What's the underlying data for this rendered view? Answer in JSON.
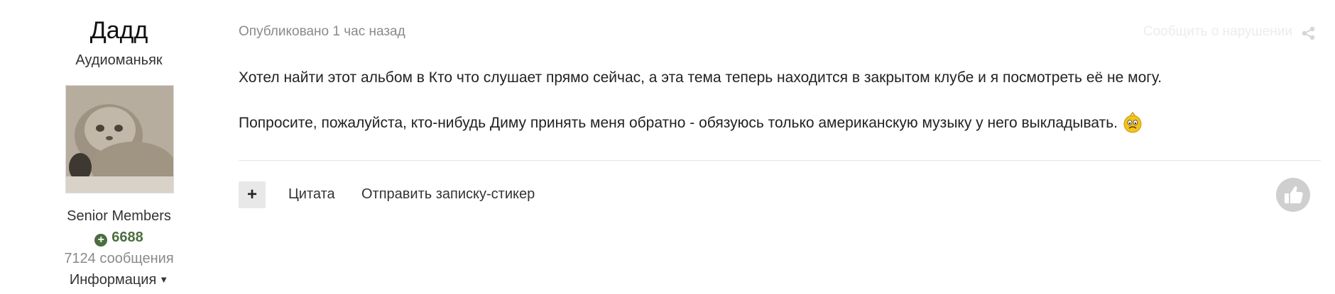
{
  "author": {
    "name": "Дадд",
    "title": "Аудиоманьяк",
    "group": "Senior Members",
    "reputation": "6688",
    "posts": "7124 сообщения",
    "info_label": "Информация"
  },
  "post": {
    "meta": "Опубликовано 1 час назад",
    "report_label": "Сообщить о нарушении",
    "paragraphs": [
      "Хотел найти этот альбом в Кто что слушает прямо сейчас, а эта тема теперь находится в закрытом клубе и я посмотреть её не могу.",
      "Попросите,  пожалуйста, кто-нибудь Диму принять меня обратно - обязуюсь только американскую музыку у него выкладывать."
    ]
  },
  "actions": {
    "plus_label": "+",
    "quote_label": "Цитата",
    "sticker_label": "Отправить записку-стикер"
  },
  "icons": {
    "share": "share-icon",
    "like": "thumbs-up-icon",
    "emoji": "worried-smiley-icon",
    "caret": "caret-down-icon",
    "rep": "plus-circle-icon"
  },
  "colors": {
    "reputation": "#4b6e3f",
    "muted": "#8a8a8a",
    "text": "#222222"
  }
}
